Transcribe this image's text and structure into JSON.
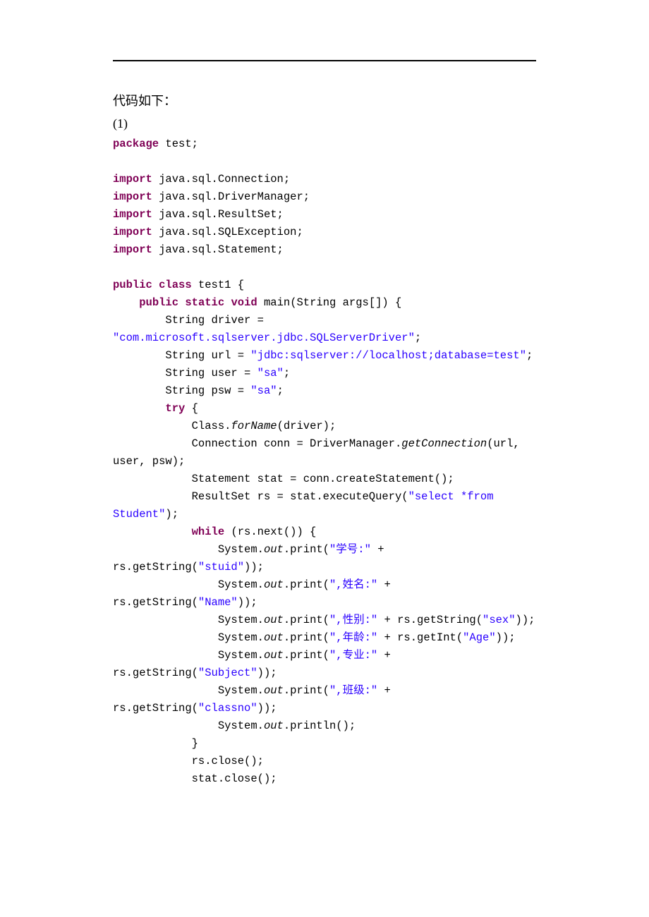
{
  "header": "代码如下：",
  "sub": "(1)",
  "code": {
    "l1": {
      "kw": "package",
      "rest": " test;"
    },
    "l2": {
      "kw": "import",
      "rest": " java.sql.Connection;"
    },
    "l3": {
      "kw": "import",
      "rest": " java.sql.DriverManager;"
    },
    "l4": {
      "kw": "import",
      "rest": " java.sql.ResultSet;"
    },
    "l5": {
      "kw": "import",
      "rest": " java.sql.SQLException;"
    },
    "l6": {
      "kw": "import",
      "rest": " java.sql.Statement;"
    },
    "l7": {
      "kw1": "public",
      "sp1": " ",
      "kw2": "class",
      "rest": " test1 {"
    },
    "l8": {
      "pad": "    ",
      "kw1": "public",
      "sp1": " ",
      "kw2": "static",
      "sp2": " ",
      "kw3": "void",
      "rest": " main(String args[]) {"
    },
    "l9": "        String driver = ",
    "l10": {
      "q": "\"com.microsoft.sqlserver.jdbc.SQLServerDriver\"",
      "rest": ";"
    },
    "l11": {
      "a": "        String url = ",
      "q": "\"jdbc:sqlserver://localhost;database=test\"",
      "b": ";"
    },
    "l12": {
      "a": "        String user = ",
      "q": "\"sa\"",
      "b": ";"
    },
    "l13": {
      "a": "        String psw = ",
      "q": "\"sa\"",
      "b": ";"
    },
    "l14": {
      "pad": "        ",
      "kw": "try",
      "rest": " {"
    },
    "l15": {
      "a": "            Class.",
      "m": "forName",
      "b": "(driver);"
    },
    "l16": {
      "a": "            Connection conn = DriverManager.",
      "m": "getConnection",
      "b": "(url, user, psw);"
    },
    "l17": "            Statement stat = conn.createStatement();",
    "l18": {
      "a": "            ResultSet rs = stat.executeQuery(",
      "q": "\"select *from Student\"",
      "b": ");"
    },
    "l19": {
      "pad": "            ",
      "kw": "while",
      "rest": " (rs.next()) {"
    },
    "l20": {
      "a": "                System.",
      "m": "out",
      "b": ".print(",
      "q1": "\"学号:\"",
      "c": " + rs.getString(",
      "q2": "\"stuid\"",
      "d": "));"
    },
    "l21": {
      "a": "                System.",
      "m": "out",
      "b": ".print(",
      "q1": "\",姓名:\"",
      "c": " + rs.getString(",
      "q2": "\"Name\"",
      "d": "));"
    },
    "l22": {
      "a": "                System.",
      "m": "out",
      "b": ".print(",
      "q1": "\",性别:\"",
      "c": " + rs.getString(",
      "q2": "\"sex\"",
      "d": "));"
    },
    "l23": {
      "a": "                System.",
      "m": "out",
      "b": ".print(",
      "q1": "\",年龄:\"",
      "c": " + rs.getInt(",
      "q2": "\"Age\"",
      "d": "));"
    },
    "l24": {
      "a": "                System.",
      "m": "out",
      "b": ".print(",
      "q1": "\",专业:\"",
      "c": " + rs.getString(",
      "q2": "\"Subject\"",
      "d": "));"
    },
    "l25": {
      "a": "                System.",
      "m": "out",
      "b": ".print(",
      "q1": "\",班级:\"",
      "c": " + rs.getString(",
      "q2": "\"classno\"",
      "d": "));"
    },
    "l26": {
      "a": "                System.",
      "m": "out",
      "b": ".println();"
    },
    "l27": "            }",
    "l28": "            rs.close();",
    "l29": "            stat.close();"
  }
}
